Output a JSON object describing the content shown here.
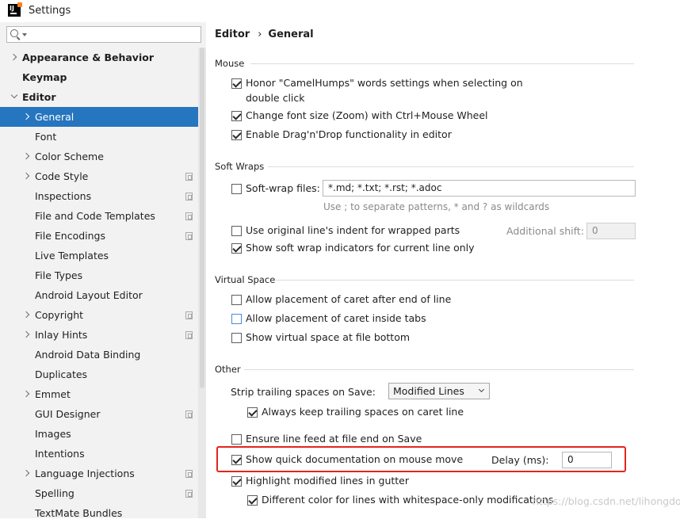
{
  "window": {
    "title": "Settings"
  },
  "search": {
    "placeholder": ""
  },
  "sidebar": {
    "items": [
      {
        "label": "Appearance & Behavior"
      },
      {
        "label": "Keymap"
      },
      {
        "label": "Editor"
      },
      {
        "label": "General"
      },
      {
        "label": "Font"
      },
      {
        "label": "Color Scheme"
      },
      {
        "label": "Code Style"
      },
      {
        "label": "Inspections"
      },
      {
        "label": "File and Code Templates"
      },
      {
        "label": "File Encodings"
      },
      {
        "label": "Live Templates"
      },
      {
        "label": "File Types"
      },
      {
        "label": "Android Layout Editor"
      },
      {
        "label": "Copyright"
      },
      {
        "label": "Inlay Hints"
      },
      {
        "label": "Android Data Binding"
      },
      {
        "label": "Duplicates"
      },
      {
        "label": "Emmet"
      },
      {
        "label": "GUI Designer"
      },
      {
        "label": "Images"
      },
      {
        "label": "Intentions"
      },
      {
        "label": "Language Injections"
      },
      {
        "label": "Spelling"
      },
      {
        "label": "TextMate Bundles"
      }
    ]
  },
  "breadcrumb": {
    "parent": "Editor",
    "separator": "›",
    "current": "General"
  },
  "mouse": {
    "title": "Mouse",
    "camelhumps_line1": "Honor \"CamelHumps\" words settings when selecting on",
    "camelhumps_line2": "double click",
    "zoom": "Change font size (Zoom) with Ctrl+Mouse Wheel",
    "dragdrop": "Enable Drag'n'Drop functionality in editor"
  },
  "softwraps": {
    "title": "Soft Wraps",
    "files_label": "Soft-wrap files:",
    "files_value": "*.md; *.txt; *.rst; *.adoc",
    "hint": "Use ; to separate patterns, * and ? as wildcards",
    "indent": "Use original line's indent for wrapped parts",
    "additional_shift_label": "Additional shift:",
    "additional_shift_value": "0",
    "indicators": "Show soft wrap indicators for current line only"
  },
  "virtualspace": {
    "title": "Virtual Space",
    "after_end": "Allow placement of caret after end of line",
    "inside_tabs": "Allow placement of caret inside tabs",
    "file_bottom": "Show virtual space at file bottom"
  },
  "other": {
    "title": "Other",
    "strip_label": "Strip trailing spaces on Save:",
    "strip_value": "Modified Lines",
    "keep_trailing": "Always keep trailing spaces on caret line",
    "line_feed": "Ensure line feed at file end on Save",
    "quick_doc": "Show quick documentation on mouse move",
    "delay_label": "Delay (ms):",
    "delay_value": "0",
    "highlight_modified": "Highlight modified lines in gutter",
    "different_color": "Different color for lines with whitespace-only modifications"
  },
  "watermark": "https://blog.csdn.net/lihongdou",
  "colors": {
    "selection": "#2675bf",
    "highlight_box": "#e4251d",
    "sidebar_bg": "#f2f2f2"
  }
}
